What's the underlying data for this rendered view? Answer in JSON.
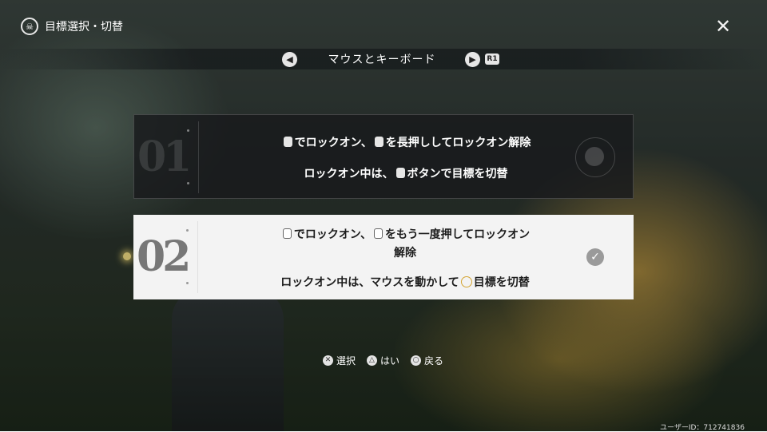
{
  "header": {
    "title": "目標選択・切替",
    "title_icon": "skull-emblem-icon",
    "close_icon": "close-x-icon"
  },
  "mode_selector": {
    "label": "マウスとキーボード",
    "prev_icon": "chevron-left-icon",
    "next_icon": "chevron-right-icon",
    "next_key": "R1"
  },
  "options": [
    {
      "number": "01",
      "selected": false,
      "line1_pre": "でロックオン、",
      "line1_post": "を長押ししてロックオン解除",
      "line2_pre": "ロックオン中は、",
      "line2_post": "ボタンで目標を切替"
    },
    {
      "number": "02",
      "selected": true,
      "line1_pre": "でロックオン、",
      "line1_post": "をもう一度押してロックオン",
      "line1_wrap": "解除",
      "line2_pre": "ロックオン中は、マウスを動かして",
      "line2_post": "目標を切替"
    }
  ],
  "footer": {
    "hints": [
      {
        "icon": "cross-button-icon",
        "glyph": "✕",
        "label": "選択"
      },
      {
        "icon": "triangle-button-icon",
        "glyph": "△",
        "label": "はい"
      },
      {
        "icon": "circle-button-icon",
        "glyph": "○",
        "label": "戻る"
      }
    ],
    "user_id": "ユーザーID：712741836"
  },
  "colors": {
    "accent_gold": "#d4a533",
    "selected_card": "#f3f3f3",
    "unselected_card": "#18191c"
  }
}
